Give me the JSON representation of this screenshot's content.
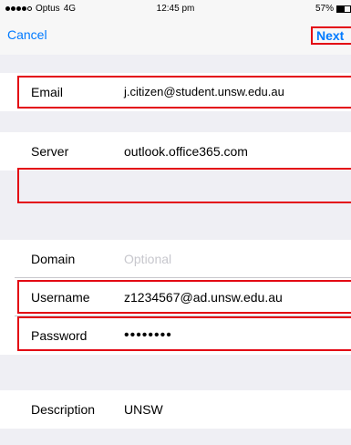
{
  "status_bar": {
    "carrier": "Optus",
    "network": "4G",
    "time": "12:45 pm",
    "battery_percent": "57%",
    "battery_level": 0.57,
    "signal_bars_filled": 4,
    "signal_bars_total": 5
  },
  "nav": {
    "cancel_label": "Cancel",
    "next_label": "Next"
  },
  "fields": {
    "email": {
      "label": "Email",
      "value": "j.citizen@student.unsw.edu.au"
    },
    "server": {
      "label": "Server",
      "value": "outlook.office365.com"
    },
    "domain": {
      "label": "Domain",
      "placeholder": "Optional"
    },
    "username": {
      "label": "Username",
      "value": "z1234567@ad.unsw.edu.au"
    },
    "password": {
      "label": "Password",
      "value": "••••••••"
    },
    "description": {
      "label": "Description",
      "value": "UNSW"
    }
  },
  "colors": {
    "accent": "#007aff",
    "highlight": "#e30613",
    "background": "#efeff4"
  }
}
